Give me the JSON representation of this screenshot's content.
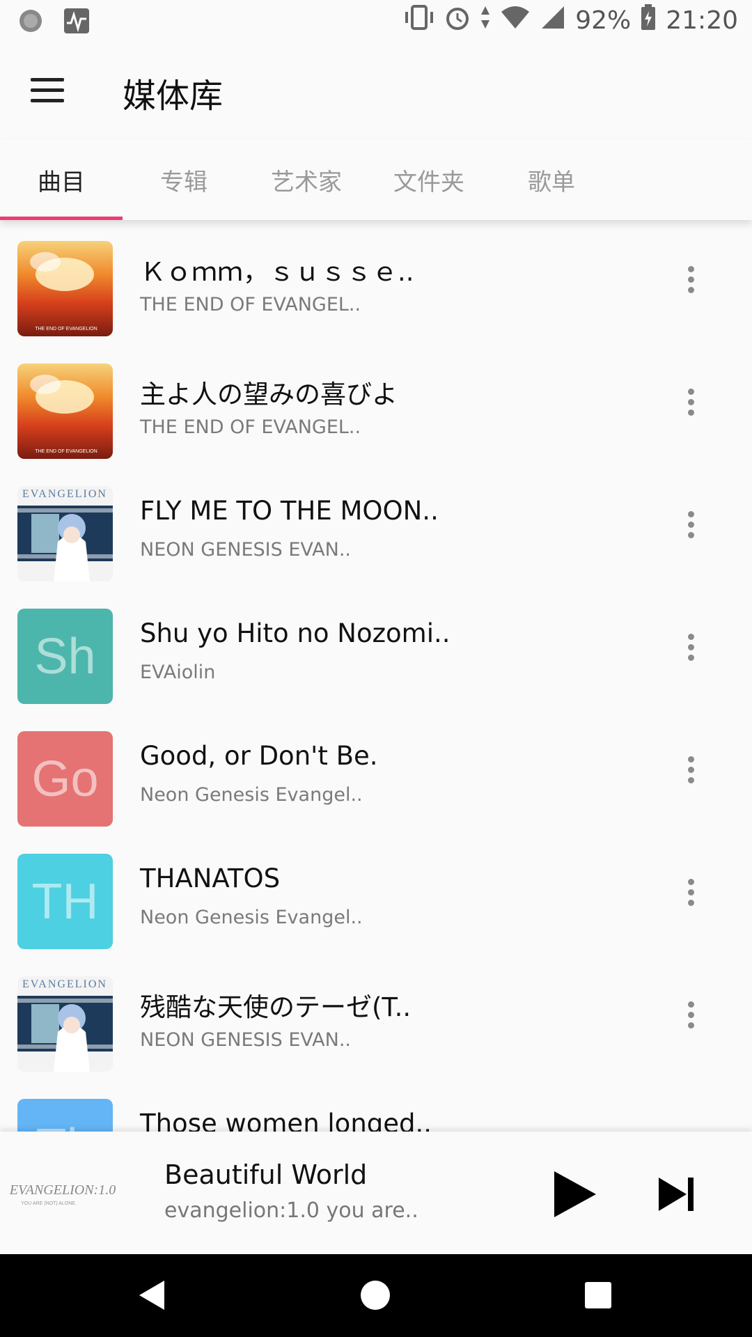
{
  "status_bar": {
    "battery": "92%",
    "time": "21:20"
  },
  "app_bar": {
    "title": "媒体库",
    "menu_icon": "hamburger-menu-icon"
  },
  "tabs": [
    {
      "label": "曲目",
      "active": true
    },
    {
      "label": "专辑",
      "active": false
    },
    {
      "label": "艺术家",
      "active": false
    },
    {
      "label": "文件夹",
      "active": false
    },
    {
      "label": "歌单",
      "active": false
    }
  ],
  "accent_color": "#ef3b72",
  "songs": [
    {
      "title": "Ｋｏｍｍ，ｓｕｓｓｅ..",
      "artist": "THE END OF EVANGEL..",
      "art": "eoe-cover"
    },
    {
      "title": "主よ人の望みの喜びよ",
      "artist": "THE END OF EVANGEL..",
      "art": "eoe-cover"
    },
    {
      "title": "FLY ME TO THE MOON..",
      "artist": "NEON GENESIS EVAN..",
      "art": "nge-cover"
    },
    {
      "title": "Shu yo Hito no Nozomi..",
      "artist": "EVAiolin",
      "art": "letter",
      "letter": "Sh",
      "color": "#4db6ac"
    },
    {
      "title": "Good, or Don't Be.",
      "artist": "Neon Genesis Evangel..",
      "art": "letter",
      "letter": "Go",
      "color": "#e57373"
    },
    {
      "title": "THANATOS",
      "artist": "Neon Genesis Evangel..",
      "art": "letter",
      "letter": "TH",
      "color": "#4dd0e1"
    },
    {
      "title": "残酷な天使のテーゼ(T..",
      "artist": "NEON GENESIS EVAN..",
      "art": "nge-cover"
    },
    {
      "title": "Those women longed..",
      "artist": "",
      "art": "letter",
      "letter": "Th",
      "color": "#64b5f6"
    }
  ],
  "now_playing": {
    "title": "Beautiful World",
    "subtitle": "evangelion:1.0 you are..",
    "art_text": "EVANGELION:1.0",
    "art_subtext": "YOU ARE (NOT) ALONE."
  }
}
